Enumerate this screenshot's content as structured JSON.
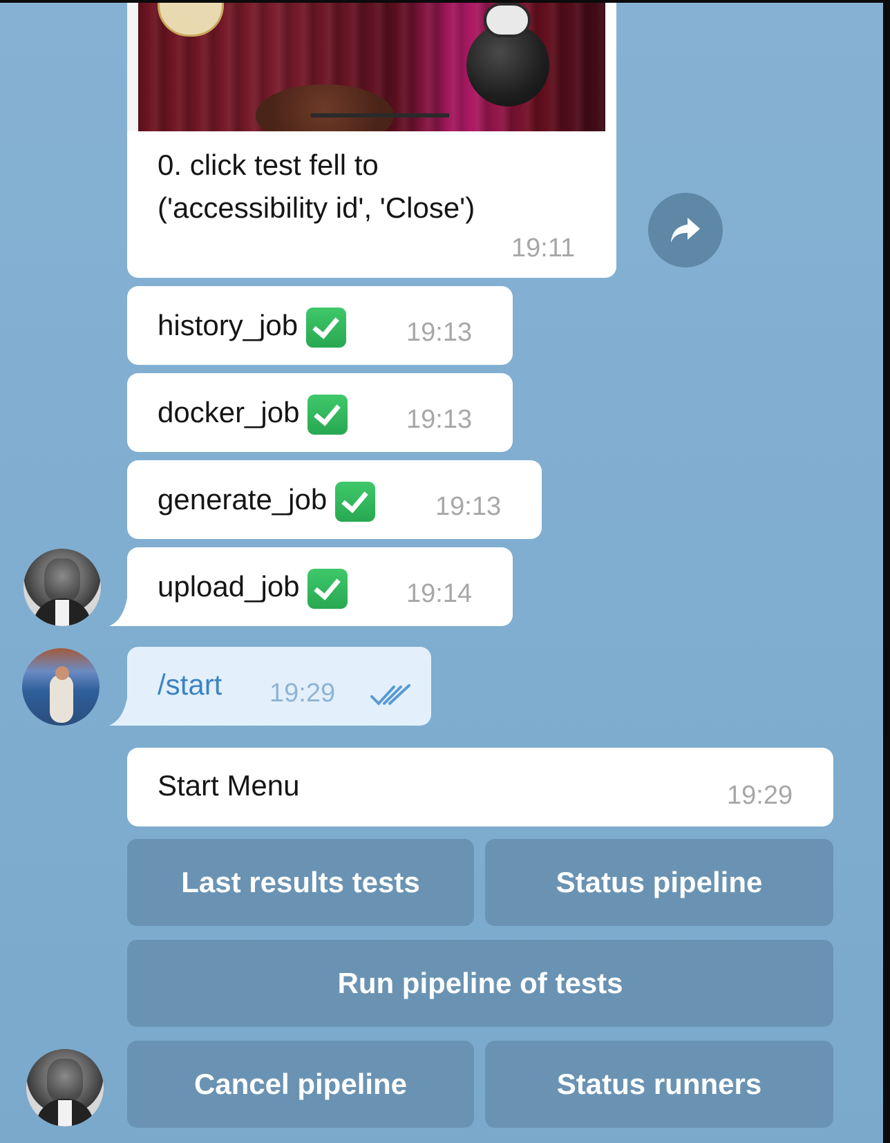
{
  "messages": {
    "test_failure": {
      "line1": "0. click test fell to",
      "line2": "('accessibility id', 'Close')",
      "time": "19:11"
    },
    "jobs": [
      {
        "label": "history_job",
        "time": "19:13"
      },
      {
        "label": "docker_job",
        "time": "19:13"
      },
      {
        "label": "generate_job",
        "time": "19:13"
      },
      {
        "label": "upload_job",
        "time": "19:14"
      }
    ],
    "sent": {
      "text": "/start",
      "time": "19:29"
    },
    "start_menu": {
      "text": "Start Menu",
      "time": "19:29"
    }
  },
  "keyboard": {
    "last_results": "Last results tests",
    "status_pipeline": "Status pipeline",
    "run_pipeline": "Run pipeline of tests",
    "cancel_pipeline": "Cancel pipeline",
    "status_runners": "Status runners"
  },
  "colors": {
    "background": "#82afd1",
    "bubble": "#ffffff",
    "sent_bubble": "#e3f0fc",
    "keyboard_button": "#6a93b3",
    "check_green": "#2fb65a"
  },
  "icons": {
    "forward": "share-forward-icon",
    "read_receipt": "double-check-icon",
    "done": "green-check-icon"
  }
}
